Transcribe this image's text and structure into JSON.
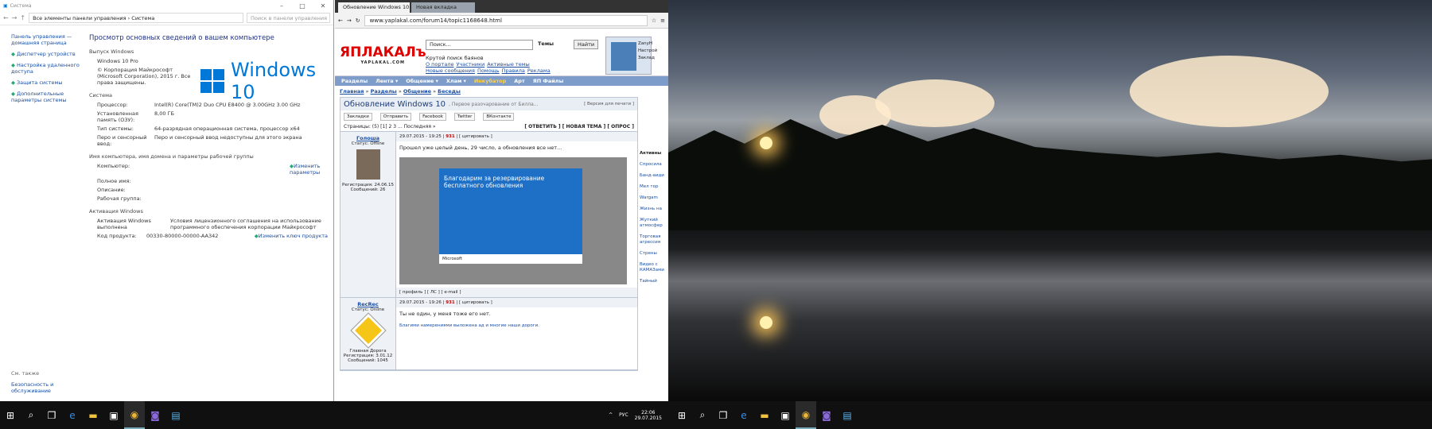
{
  "system_window": {
    "title": "Система",
    "path": "Все элементы панели управления  ›  Система",
    "search_placeholder": "Поиск в панели управления",
    "left_links": [
      "Панель управления — домашняя страница",
      "Диспетчер устройств",
      "Настройка удаленного доступа",
      "Защита системы",
      "Дополнительные параметры системы"
    ],
    "heading": "Просмотр основных сведений о вашем компьютере",
    "edition_section": "Выпуск Windows",
    "edition": "Windows 10 Pro",
    "copyright": "© Корпорация Майкрософт (Microsoft Corporation), 2015 г. Все права защищены.",
    "windows_logo_text": "Windows 10",
    "system_section": "Система",
    "system_rows": [
      {
        "k": "Процессор:",
        "v": "Intel(R) Core(TM)2 Duo CPU     E8400  @ 3.00GHz   3.00 GHz"
      },
      {
        "k": "Установленная память (ОЗУ):",
        "v": "8,00 ГБ"
      },
      {
        "k": "Тип системы:",
        "v": "64-разрядная операционная система, процессор x64"
      },
      {
        "k": "Перо и сенсорный ввод:",
        "v": "Перо и сенсорный ввод недоступны для этого экрана"
      }
    ],
    "name_section": "Имя компьютера, имя домена и параметры рабочей группы",
    "name_rows": [
      {
        "k": "Компьютер:",
        "v": ""
      },
      {
        "k": "Полное имя:",
        "v": ""
      },
      {
        "k": "Описание:",
        "v": ""
      },
      {
        "k": "Рабочая группа:",
        "v": ""
      }
    ],
    "change_params": "Изменить параметры",
    "activation_section": "Активация Windows",
    "activation_status": "Активация Windows выполнена",
    "license_link": "Условия лицензионного соглашения на использование программного обеспечения корпорации Майкрософт",
    "product_key_label": "Код продукта:",
    "product_key": "00330-80000-00000-AA342",
    "change_key": "Изменить ключ продукта",
    "see_also": "См. также",
    "security_link": "Безопасность и обслуживание"
  },
  "browser": {
    "tabs": [
      "Обновление Windows 10...",
      "Новая вкладка"
    ],
    "url": "www.yaplakal.com/forum14/topic1168648.html",
    "logo": "ЯПЛАКАЛъ",
    "logo_sub": "YAPLAKAL.COM",
    "search_placeholder": "Поиск...",
    "themes": "Темы",
    "find_btn": "Найти",
    "slogan": "Крутой поиск баянов",
    "sub_links": [
      "О портале",
      "Участники",
      "Активные темы",
      "Новые сообщения",
      "Помощь",
      "Правила",
      "Реклама"
    ],
    "user_box": [
      "ZanyH",
      "Настрой",
      "Заклад"
    ],
    "nav": [
      "Разделы",
      "Лента ▾",
      "Общение ▾",
      "Хлам ▾",
      "Инкубатор",
      "Арт",
      "ЯП Файлы"
    ],
    "crumbs": [
      "Главная",
      "Разделы",
      "Общение",
      "Беседы"
    ],
    "topic_title": "Обновление Windows 10",
    "topic_desc": ", Первое разочарование от Билла...",
    "topic_back": "[ Версия для печати ]",
    "share": [
      "Закладки",
      "Отправить",
      "Facebook",
      "Twitter",
      "ВКонтакте"
    ],
    "pages_text": "Страницы: (5) [1] 2 3 ... Последняя »",
    "actions": "[ ОТВЕТИТЬ ] [ НОВАЯ ТЕМА ] [ ОПРОС ]",
    "posts": [
      {
        "name": "Голоша",
        "status": "Статус: Offline",
        "reg": "Регистрация: 24.06.15",
        "msgs": "Сообщений: 26",
        "meta": "29.07.2015 - 19:25",
        "num": "931",
        "quote": "[ цитировать ]",
        "text": "Прошел уже целый день, 29 число, а обновления все нет...",
        "shot_title": "Благодарим за резервирование бесплатного обновления",
        "shot_foot": "Microsoft",
        "footer": "[ профиль ] [ ЛС ] [ e-mail ]"
      },
      {
        "name": "RecRec",
        "status": "Статус: Online",
        "reg": "Регистрация: 3.01.12",
        "msgs": "Сообщений: 1045",
        "meta": "29.07.2015 - 19:26",
        "num": "931",
        "quote": "[ цитировать ]",
        "text": "Ты не один, у меня тоже его нет.",
        "sig": "Благими намерениями выложена ад и многие наши дороги.",
        "rank": "Главная Дорога"
      }
    ],
    "right_head": "Активны",
    "right_links": [
      "Спросила",
      "Банд-аиди",
      "Мел тор",
      "Wargam",
      "Жизнь на",
      "Жуткий атмосфер",
      "Торговая агрессия",
      "Стрены",
      "Видео с КАМАЗами",
      "Тайный"
    ]
  },
  "taskbar_left": {
    "icons": [
      "windows-icon",
      "search-icon",
      "task-view-icon",
      "edge-icon",
      "explorer-icon",
      "store-icon",
      "chrome-icon",
      "app-icon",
      "window-icon"
    ],
    "tray": [
      "^",
      "РУС"
    ],
    "time": "22:06",
    "date": "29.07.2015"
  },
  "taskbar_right": {
    "icons": [
      "windows-icon",
      "search-icon",
      "task-view-icon",
      "edge-icon",
      "explorer-icon",
      "store-icon",
      "chrome-icon",
      "app-icon",
      "window-icon"
    ]
  }
}
